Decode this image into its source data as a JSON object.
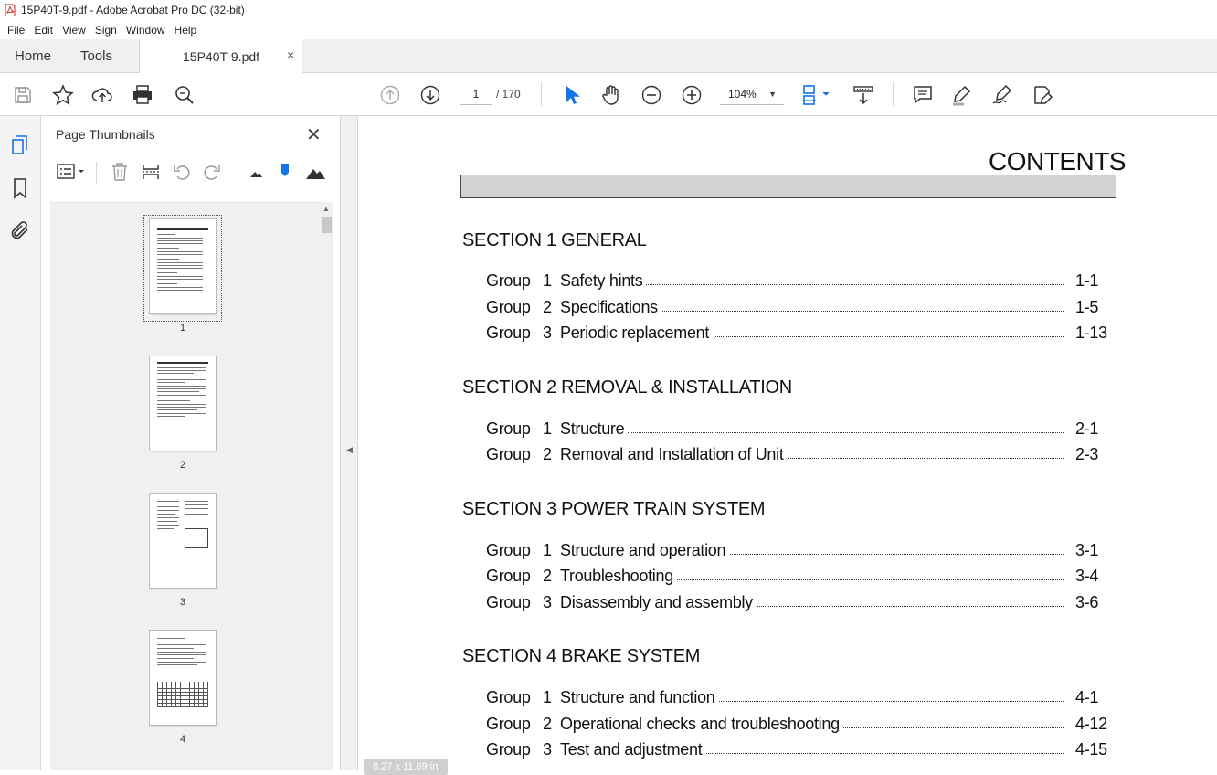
{
  "window": {
    "title": "15P40T-9.pdf - Adobe Acrobat Pro DC (32-bit)"
  },
  "menu": [
    "File",
    "Edit",
    "View",
    "Sign",
    "Window",
    "Help"
  ],
  "tabs": {
    "home": "Home",
    "tools": "Tools",
    "document": "15P40T-9.pdf",
    "close": "×"
  },
  "toolbar": {
    "current_page": "1",
    "total_pages": "/  170",
    "zoom": "104%"
  },
  "panel": {
    "title": "Page Thumbnails",
    "close": "✕",
    "thumbnails": [
      {
        "num": "1",
        "selected": true
      },
      {
        "num": "2",
        "selected": false
      },
      {
        "num": "3",
        "selected": false
      },
      {
        "num": "4",
        "selected": false
      }
    ]
  },
  "document": {
    "title": "CONTENTS",
    "sections": [
      {
        "heading": "SECTION 1  GENERAL",
        "rows": [
          {
            "group": "Group",
            "num": "1",
            "title": "Safety hints",
            "page": "1-1"
          },
          {
            "group": "Group",
            "num": "2",
            "title": "Specifications",
            "page": "1-5"
          },
          {
            "group": "Group",
            "num": "3",
            "title": "Periodic replacement",
            "page": "1-13"
          }
        ]
      },
      {
        "heading": "SECTION 2  REMOVAL & INSTALLATION",
        "rows": [
          {
            "group": "Group",
            "num": "1",
            "title": "Structure",
            "page": "2-1"
          },
          {
            "group": "Group",
            "num": "2",
            "title": "Removal and Installation of Unit",
            "page": "2-3"
          }
        ]
      },
      {
        "heading": "SECTION 3  POWER TRAIN SYSTEM",
        "rows": [
          {
            "group": "Group",
            "num": "1",
            "title": "Structure and operation",
            "page": "3-1"
          },
          {
            "group": "Group",
            "num": "2",
            "title": "Troubleshooting",
            "page": "3-4"
          },
          {
            "group": "Group",
            "num": "3",
            "title": "Disassembly and assembly",
            "page": "3-6"
          }
        ]
      },
      {
        "heading": "SECTION 4  BRAKE SYSTEM",
        "rows": [
          {
            "group": "Group",
            "num": "1",
            "title": "Structure and function",
            "page": "4-1"
          },
          {
            "group": "Group",
            "num": "2",
            "title": "Operational checks and troubleshooting",
            "page": "4-12"
          },
          {
            "group": "Group",
            "num": "3",
            "title": "Test and adjustment",
            "page": "4-15"
          }
        ]
      }
    ],
    "page_size": "8.27 x 11.69 in"
  },
  "colors": {
    "accent": "#1473e6",
    "pdf_red": "#d21f1f"
  }
}
